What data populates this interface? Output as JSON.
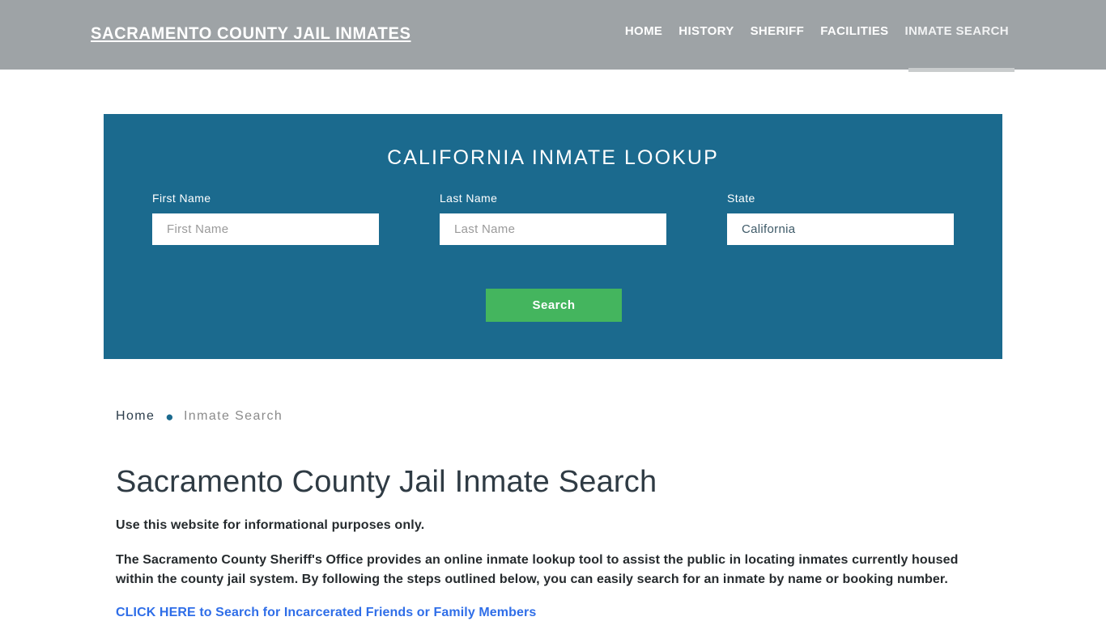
{
  "header": {
    "site_title": "SACRAMENTO COUNTY JAIL INMATES",
    "background_color": "#9ea3a6",
    "nav": [
      {
        "label": "HOME",
        "active": false
      },
      {
        "label": "HISTORY",
        "active": false
      },
      {
        "label": "SHERIFF",
        "active": false
      },
      {
        "label": "FACILITIES",
        "active": false
      },
      {
        "label": "INMATE SEARCH",
        "active": true
      }
    ]
  },
  "search_panel": {
    "title": "CALIFORNIA INMATE LOOKUP",
    "background_color": "#1b6a8e",
    "fields": [
      {
        "label": "First Name",
        "placeholder": "First Name",
        "value": ""
      },
      {
        "label": "Last Name",
        "placeholder": "Last Name",
        "value": ""
      },
      {
        "label": "State",
        "placeholder": "",
        "value": "California"
      }
    ],
    "submit_label": "Search",
    "submit_color": "#44b55e"
  },
  "breadcrumb": {
    "home_label": "Home",
    "separator": "●",
    "current_label": "Inmate Search",
    "separator_color": "#1b6a8e"
  },
  "main": {
    "page_title": "Sacramento County Jail Inmate Search",
    "lead": "Use this website for informational purposes only.",
    "paragraph": "The Sacramento County Sheriff's Office provides an online inmate lookup tool to assist the public in locating inmates currently housed within the county jail system. By following the steps outlined below, you can easily search for an inmate by name or booking number.",
    "cta_link": "CLICK HERE to Search for Incarcerated Friends or Family Members",
    "cta_color": "#2f6ee8"
  }
}
